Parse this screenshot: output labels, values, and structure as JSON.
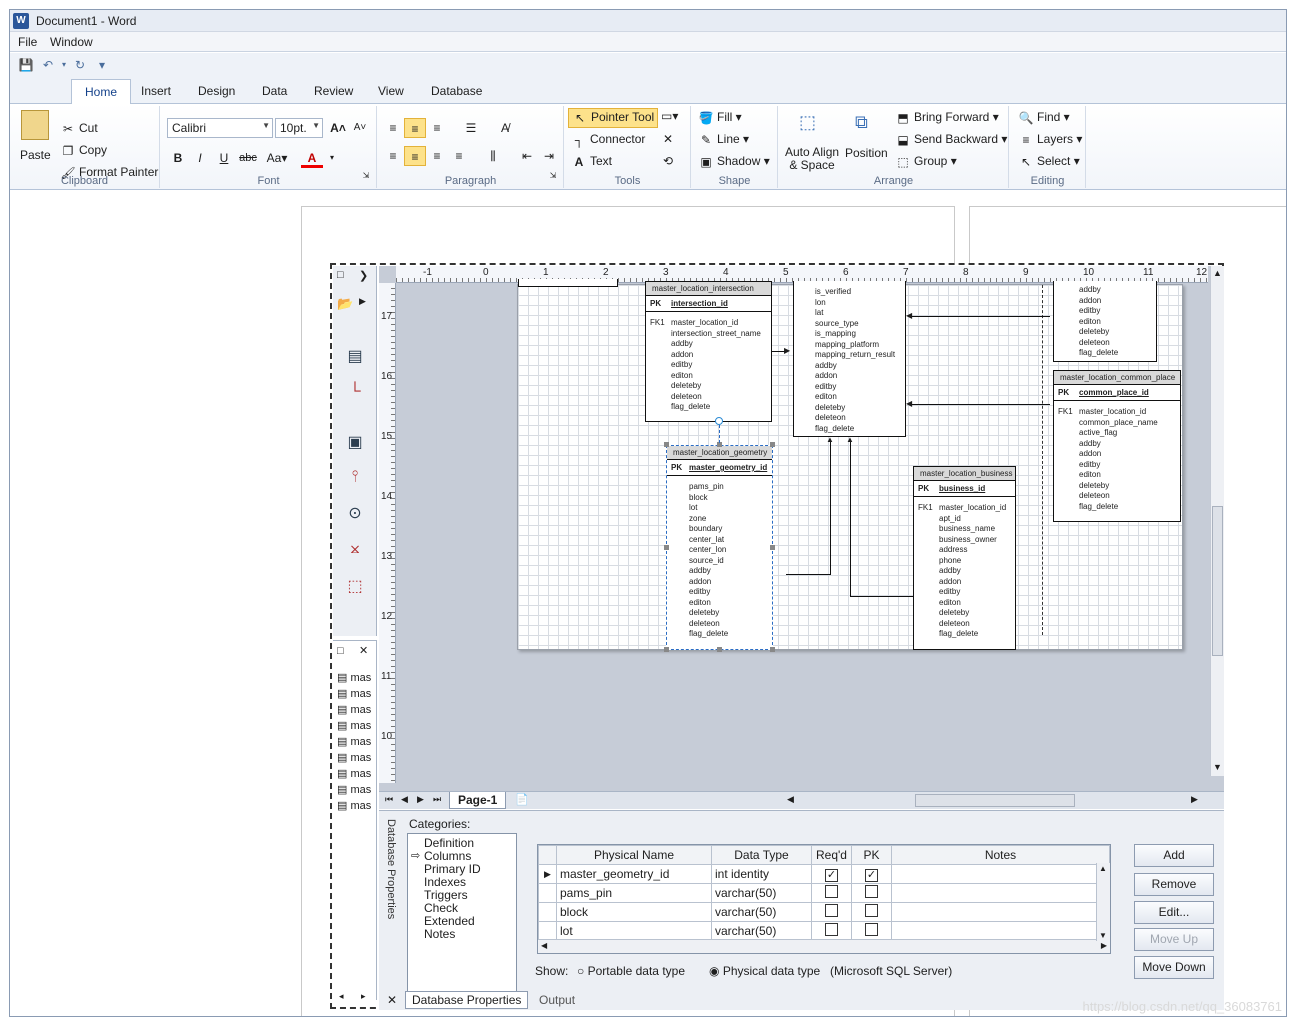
{
  "window": {
    "title": "Document1 - Word",
    "app_icon": "W"
  },
  "menu": [
    "File",
    "Window"
  ],
  "tabs": [
    {
      "label": "Home",
      "active": true
    },
    {
      "label": "Insert"
    },
    {
      "label": "Design"
    },
    {
      "label": "Data"
    },
    {
      "label": "Review"
    },
    {
      "label": "View"
    },
    {
      "label": "Database"
    }
  ],
  "ribbon": {
    "clipboard": {
      "label": "Clipboard",
      "paste": "Paste",
      "cut": "Cut",
      "copy": "Copy",
      "format_painter": "Format Painter"
    },
    "font": {
      "label": "Font",
      "font_name": "Calibri",
      "font_size": "10pt."
    },
    "paragraph": {
      "label": "Paragraph"
    },
    "tools": {
      "label": "Tools",
      "pointer": "Pointer Tool",
      "connector": "Connector",
      "text": "Text"
    },
    "shape": {
      "label": "Shape",
      "fill": "Fill",
      "line": "Line",
      "shadow": "Shadow"
    },
    "arrange": {
      "label": "Arrange",
      "auto_align": "Auto Align",
      "auto_align2": "& Space",
      "position": "Position",
      "bring_forward": "Bring Forward",
      "send_backward": "Send Backward",
      "group": "Group"
    },
    "editing": {
      "label": "Editing",
      "find": "Find",
      "layers": "Layers",
      "select": "Select"
    }
  },
  "ruler": {
    "h": [
      "-1",
      "0",
      "1",
      "2",
      "3",
      "4",
      "5",
      "6",
      "7",
      "8",
      "9",
      "10",
      "11",
      "12"
    ],
    "v": [
      "17",
      "16",
      "15",
      "14",
      "13",
      "12",
      "11",
      "10"
    ]
  },
  "tables": {
    "intersection": {
      "name": "master_location_intersection",
      "pk": "intersection_id",
      "fk": "FK1",
      "cols": [
        "master_location_id",
        "intersection_street_name",
        "addby",
        "addon",
        "editby",
        "editon",
        "deleteby",
        "deleteon",
        "flag_delete"
      ]
    },
    "middle": {
      "cols": [
        "is_verified",
        "lon",
        "lat",
        "source_type",
        "is_mapping",
        "mapping_platform",
        "mapping_return_result",
        "addby",
        "addon",
        "editby",
        "editon",
        "deleteby",
        "deleteon",
        "flag_delete"
      ]
    },
    "topright": {
      "cols": [
        "addby",
        "addon",
        "editby",
        "editon",
        "deleteby",
        "deleteon",
        "flag_delete"
      ]
    },
    "common_place": {
      "name": "master_location_common_place",
      "pk": "common_place_id",
      "fk": "FK1",
      "cols": [
        "master_location_id",
        "common_place_name",
        "active_flag",
        "addby",
        "addon",
        "editby",
        "editon",
        "deleteby",
        "deleteon",
        "flag_delete"
      ]
    },
    "geometry": {
      "name": "master_location_geometry",
      "pk": "master_geometry_id",
      "cols": [
        "pams_pin",
        "block",
        "lot",
        "zone",
        "boundary",
        "center_lat",
        "center_lon",
        "source_id",
        "addby",
        "addon",
        "editby",
        "editon",
        "deleteby",
        "deleteon",
        "flag_delete"
      ]
    },
    "business": {
      "name": "master_location_business",
      "pk": "business_id",
      "fk": "FK1",
      "cols": [
        "master_location_id",
        "apt_id",
        "business_name",
        "business_owner",
        "address",
        "phone",
        "addby",
        "addon",
        "editby",
        "editon",
        "deleteby",
        "deleteon",
        "flag_delete"
      ]
    }
  },
  "shape_list": [
    "mas",
    "mas",
    "mas",
    "mas",
    "mas",
    "mas",
    "mas",
    "mas",
    "mas"
  ],
  "page_tab": "Page-1",
  "key_labels": {
    "pk": "PK"
  },
  "db_props": {
    "vertical_title": "Database Properties",
    "categories_label": "Categories:",
    "categories": [
      "Definition",
      "Columns",
      "Primary ID",
      "Indexes",
      "Triggers",
      "Check",
      "Extended",
      "Notes"
    ],
    "headers": [
      "Physical Name",
      "Data Type",
      "Req'd",
      "PK",
      "Notes"
    ],
    "rows": [
      {
        "name": "master_geometry_id",
        "type": "int identity",
        "reqd": true,
        "pk": true
      },
      {
        "name": "pams_pin",
        "type": "varchar(50)",
        "reqd": false,
        "pk": false
      },
      {
        "name": "block",
        "type": "varchar(50)",
        "reqd": false,
        "pk": false
      },
      {
        "name": "lot",
        "type": "varchar(50)",
        "reqd": false,
        "pk": false
      }
    ],
    "buttons": {
      "add": "Add",
      "remove": "Remove",
      "edit": "Edit...",
      "move_up": "Move Up",
      "move_down": "Move Down"
    },
    "show_label": "Show:",
    "portable": "Portable data type",
    "physical": "Physical data type",
    "server": "(Microsoft SQL Server)",
    "bottom_tabs": [
      "Database Properties",
      "Output"
    ]
  },
  "watermark": "https://blog.csdn.net/qq_36083761"
}
